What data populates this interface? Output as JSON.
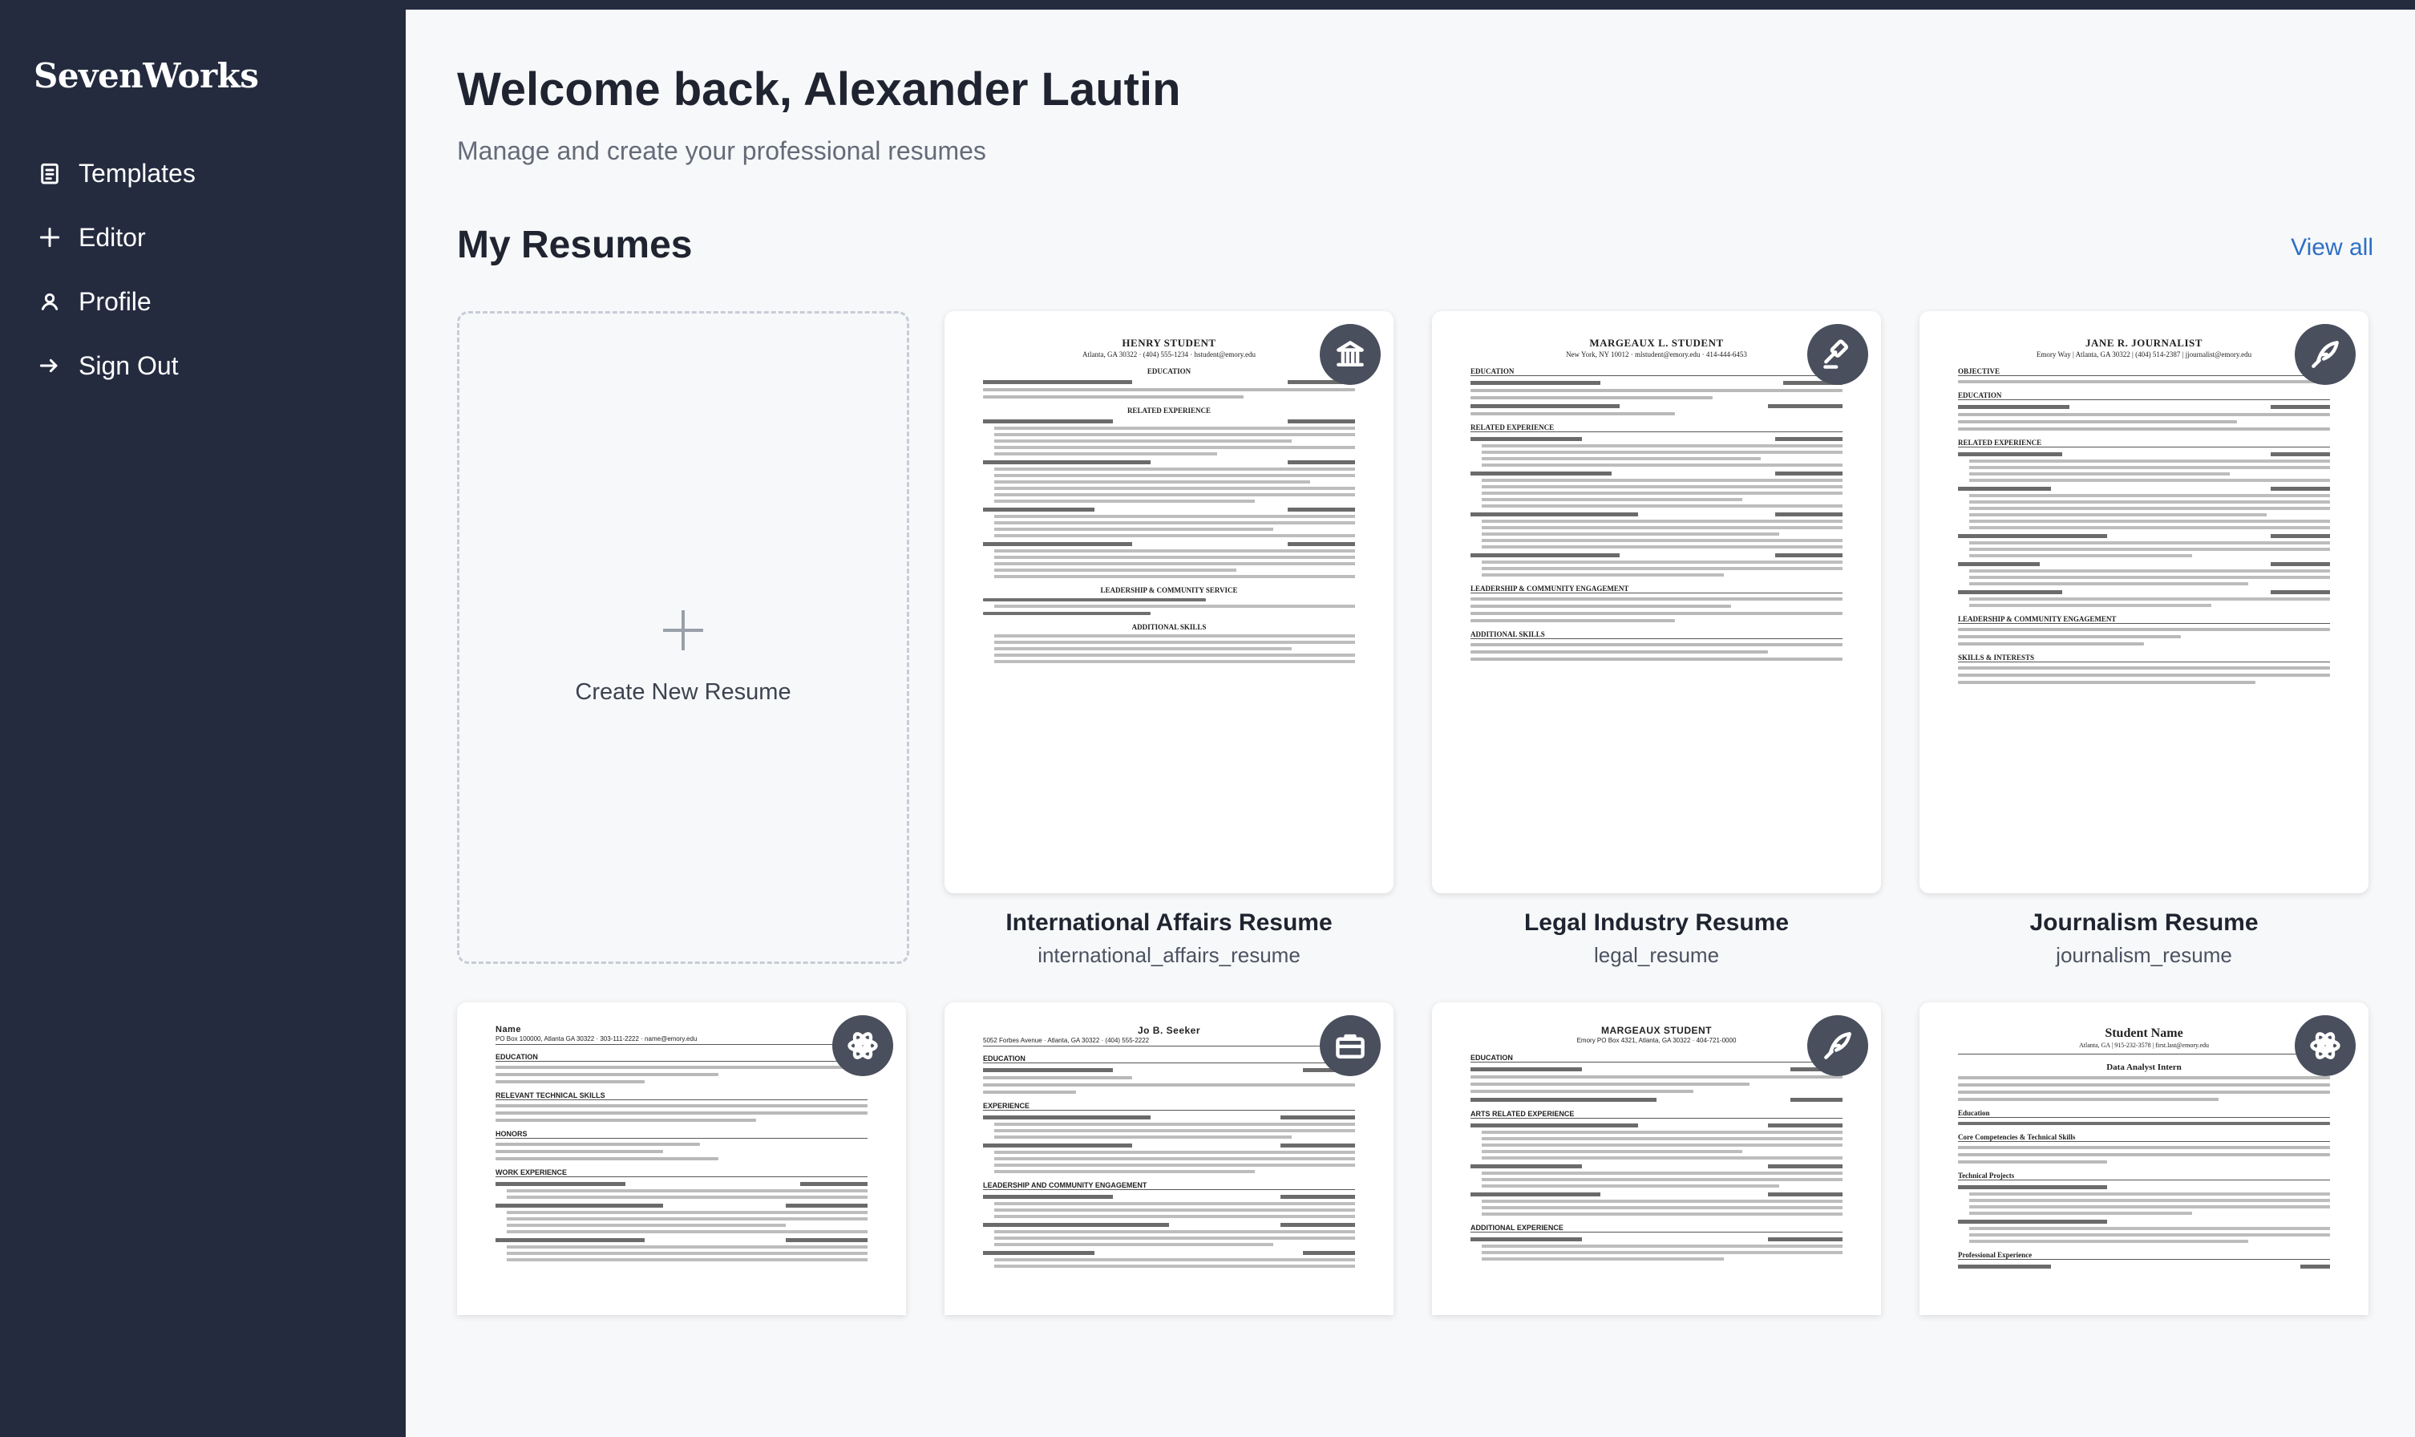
{
  "brand": {
    "name": "SevenWorks"
  },
  "nav": [
    {
      "label": "Templates",
      "icon": "clipboard-icon"
    },
    {
      "label": "Editor",
      "icon": "plus-icon"
    },
    {
      "label": "Profile",
      "icon": "user-icon"
    },
    {
      "label": "Sign Out",
      "icon": "sign-out-arrow-icon"
    }
  ],
  "main": {
    "welcome": "Welcome back, Alexander Lautin",
    "subtitle": "Manage and create your professional resumes",
    "section_title": "My Resumes",
    "view_all": "View all",
    "create_label": "Create New Resume"
  },
  "resumes": [
    {
      "title": "International Affairs Resume",
      "file": "international_affairs_resume",
      "icon": "institution-building-icon",
      "doc_name": "HENRY STUDENT",
      "doc_contact": "Atlanta, GA 30322 · (404) 555-1234 · hstudent@emory.edu"
    },
    {
      "title": "Legal Industry Resume",
      "file": "legal_resume",
      "icon": "gavel-icon",
      "doc_name": "MARGEAUX L. STUDENT",
      "doc_contact": "New York, NY 10012 · mlstudent@emory.edu · 414-444-6453"
    },
    {
      "title": "Journalism Resume",
      "file": "journalism_resume",
      "icon": "quill-pen-icon",
      "doc_name": "JANE R. JOURNALIST",
      "doc_contact": "Emory Way | Atlanta, GA 30322 | (404) 514-2387 | jjournalist@emory.edu"
    },
    {
      "title": "",
      "file": "",
      "icon": "atom-icon",
      "doc_name": "Name",
      "doc_contact": "PO Box 100000, Atlanta GA 30322 · 303-111-2222 · name@emory.edu"
    },
    {
      "title": "",
      "file": "",
      "icon": "briefcase-icon",
      "doc_name": "Jo B. Seeker",
      "doc_contact": "5052 Forbes Avenue · Atlanta, GA 30322 · (404) 555-2222"
    },
    {
      "title": "",
      "file": "",
      "icon": "quill-pen-icon",
      "doc_name": "MARGEAUX STUDENT",
      "doc_contact": "Emory PO Box 4321, Atlanta, GA 30322 · 404-721-0000"
    },
    {
      "title": "",
      "file": "",
      "icon": "atom-icon",
      "doc_name": "Student Name",
      "doc_contact": "Atlanta, GA | 915-232-3578 | first.last@emory.edu"
    }
  ]
}
